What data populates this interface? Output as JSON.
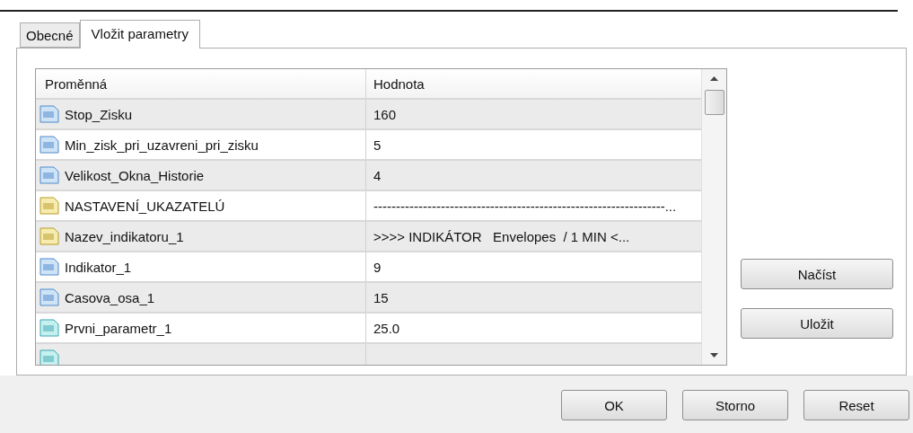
{
  "tabs": [
    {
      "label": "Obecné",
      "selected": false
    },
    {
      "label": "Vložit parametry",
      "selected": true
    }
  ],
  "table": {
    "columns": [
      "Proměnná",
      "Hodnota"
    ],
    "rows": [
      {
        "kind": "integer",
        "name": "Stop_Zisku",
        "value": "160"
      },
      {
        "kind": "integer",
        "name": "Min_zisk_pri_uzavreni_pri_zisku",
        "value": "5"
      },
      {
        "kind": "integer",
        "name": "Velikost_Okna_Historie",
        "value": "4"
      },
      {
        "kind": "text",
        "name": "NASTAVENÍ_UKAZATELÚ",
        "value": "-----------------------------------------------------------------..."
      },
      {
        "kind": "text",
        "name": "Nazev_indikatoru_1",
        "value": ">>>> INDIKÁTOR   Envelopes  / 1 MIN <..."
      },
      {
        "kind": "integer",
        "name": "Indikator_1",
        "value": "9"
      },
      {
        "kind": "integer",
        "name": "Casova_osa_1",
        "value": "15"
      },
      {
        "kind": "fraction",
        "name": "Prvni_parametr_1",
        "value": "25.0"
      },
      {
        "kind": "fraction"
      }
    ]
  },
  "side_buttons": [
    "Načíst",
    "Uložit"
  ],
  "buttons": [
    "OK",
    "Storno",
    "Reset"
  ]
}
